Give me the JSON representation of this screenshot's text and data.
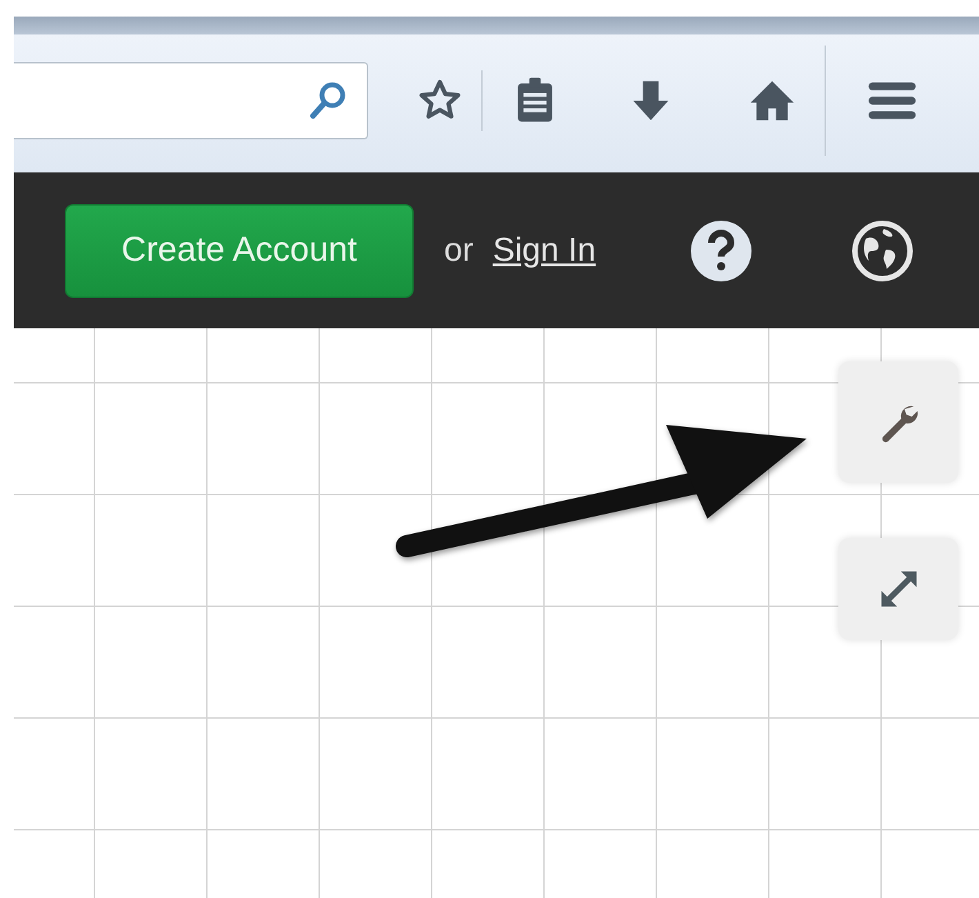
{
  "header": {
    "create_account": "Create Account",
    "separator": "or",
    "sign_in": "Sign In"
  }
}
